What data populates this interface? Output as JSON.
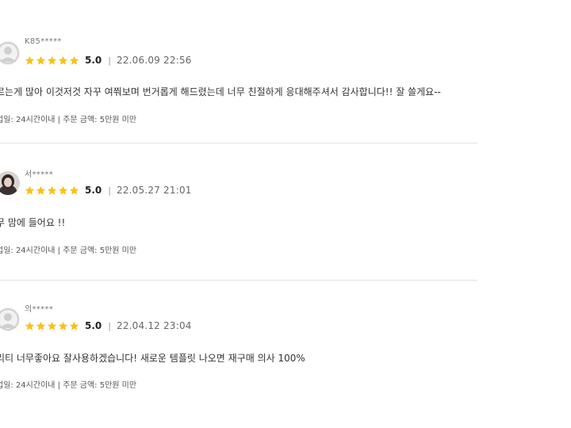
{
  "colors": {
    "star": "#f7c21c",
    "divider": "#e2e2e2",
    "text": "#333333",
    "muted": "#777777"
  },
  "reviews": [
    {
      "username": "K85*****",
      "avatar_icon": "default-avatar-icon",
      "score": "5.0",
      "separator": "|",
      "date": "22.06.09 22:56",
      "body": "르는게 많아 이것저것 자꾸 여쭤보며 번거롭게 해드렸는데 너무 친절하게 응대해주셔서 감사합니다!! 잘 쓸게요--",
      "meta": "업일: 24시간이내 | 주문 금액: 5만원 미만"
    },
    {
      "username": "서*****",
      "avatar_icon": "profile-photo",
      "score": "5.0",
      "separator": "|",
      "date": "22.05.27 21:01",
      "body": "무 맘에 들어요 !!",
      "meta": "업일: 24시간이내 | 주문 금액: 5만원 미만"
    },
    {
      "username": "의*****",
      "avatar_icon": "default-avatar-icon",
      "score": "5.0",
      "separator": "|",
      "date": "22.04.12 23:04",
      "body": "리티 너무좋아요 잘사용하겠습니다! 새로운 템플릿 나오면 재구매 의사 100%",
      "meta": "업일: 24시간이내 | 주문 금액: 5만원 미만"
    }
  ]
}
